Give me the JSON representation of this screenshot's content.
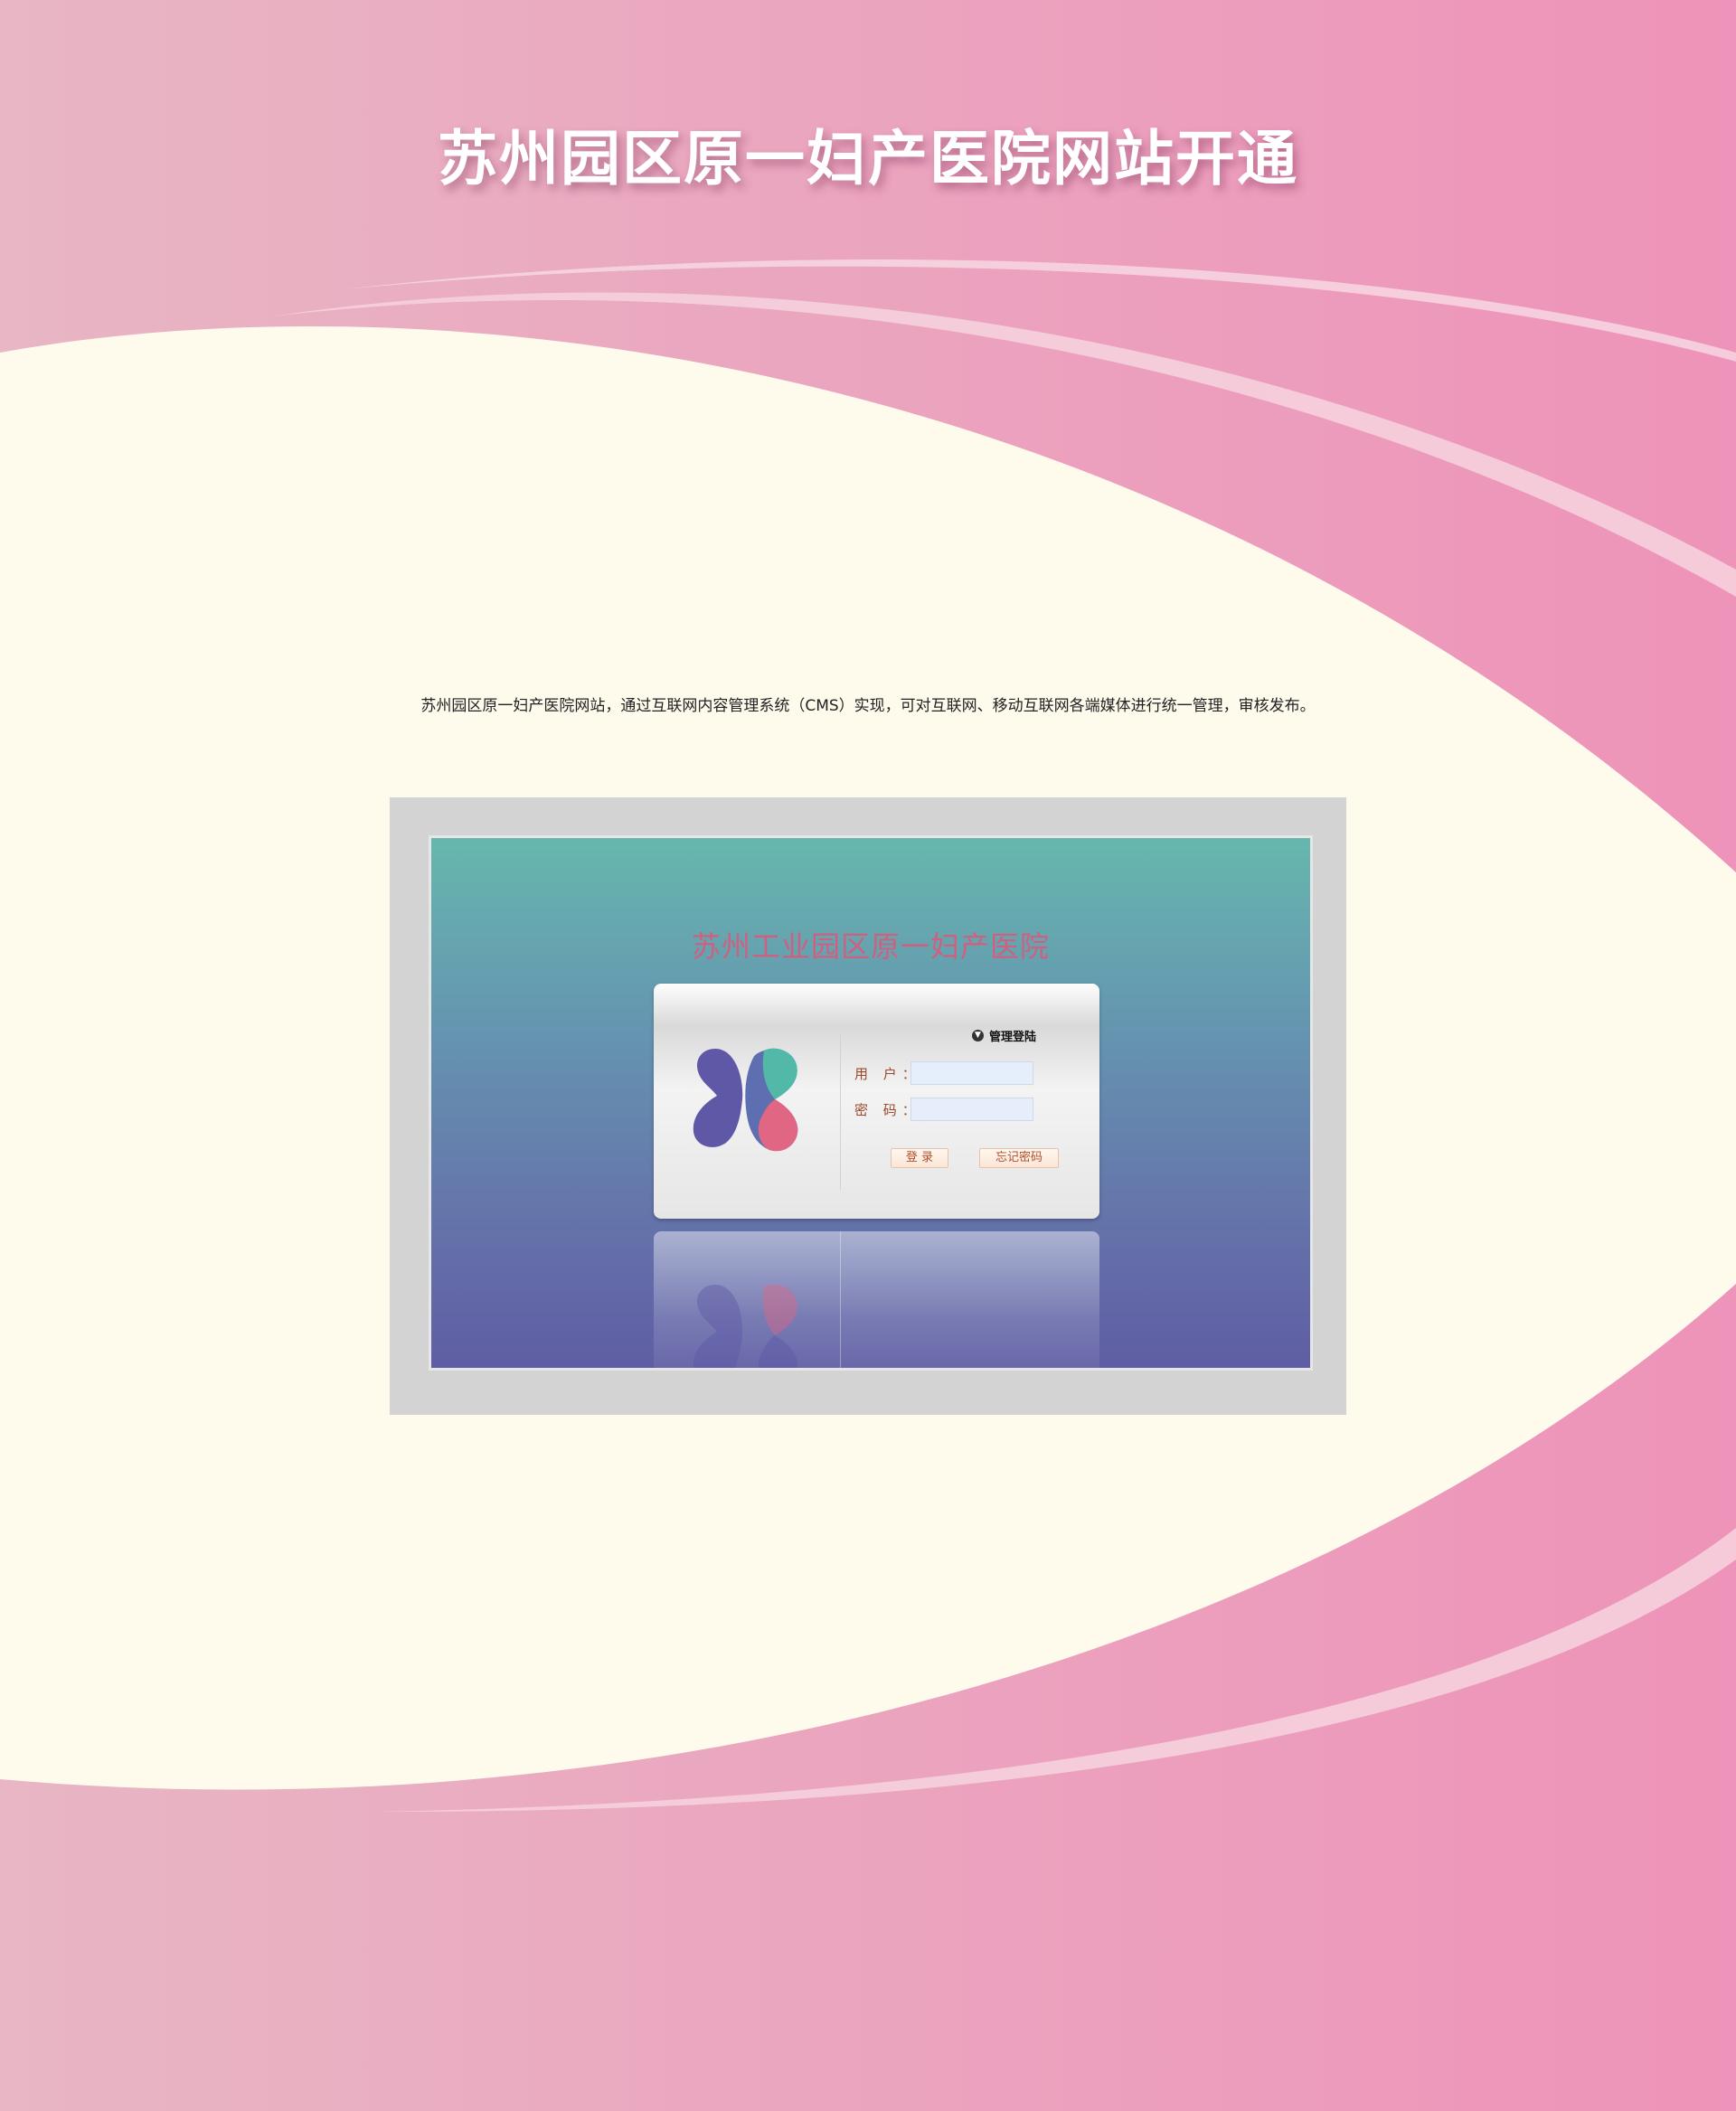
{
  "header": {
    "title": "苏州园区原一妇产医院网站开通"
  },
  "description": {
    "text": "苏州园区原一妇产医院网站，通过互联网内容管理系统（CMS）实现，可对互联网、移动互联网各端媒体进行统一管理，审核发布。"
  },
  "screenshot": {
    "hospital_name": "苏州工业园区原一妇产医院",
    "login_panel": {
      "title": "管理登陆",
      "username_label": "用 户：",
      "password_label": "密 码：",
      "username_value": "",
      "password_value": "",
      "login_button": "登 录",
      "forgot_button": "忘记密码"
    }
  },
  "colors": {
    "background_pink": "#eba3bf",
    "cream": "#fefbed",
    "hospital_name": "#d0607f",
    "login_text": "#9a4a2a",
    "logo_purple": "#5e58a6",
    "logo_teal": "#52b8a8",
    "logo_pink": "#e06684"
  },
  "icons": {
    "logo": "hospital-logo-icon",
    "title_dot": "circle-arrow-icon"
  }
}
